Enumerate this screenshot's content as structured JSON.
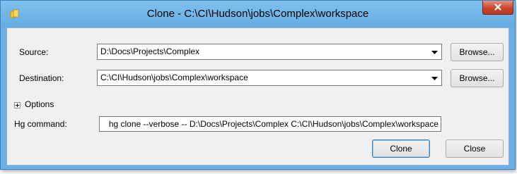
{
  "window": {
    "title": "Clone - C:\\CI\\Hudson\\jobs\\Complex\\workspace",
    "app_icon": "tortoisehg-icon",
    "close_icon": "close-icon"
  },
  "form": {
    "source": {
      "label": "Source:",
      "value": "D:\\Docs\\Projects\\Complex",
      "browse_label": "Browse..."
    },
    "destination": {
      "label": "Destination:",
      "value": "C:\\CI\\Hudson\\jobs\\Complex\\workspace",
      "browse_label": "Browse..."
    },
    "options": {
      "label": "Options",
      "expander_icon": "plus-expander-icon"
    },
    "hg_command": {
      "label": "Hg command:",
      "value": "hg clone --verbose -- D:\\Docs\\Projects\\Complex C:\\CI\\Hudson\\jobs\\Complex\\workspace"
    }
  },
  "buttons": {
    "clone_label": "Clone",
    "close_label": "Close"
  },
  "colors": {
    "titlebar": "#6ab0e6",
    "close_button": "#c8452f",
    "client_background": "#f0f0f0"
  }
}
